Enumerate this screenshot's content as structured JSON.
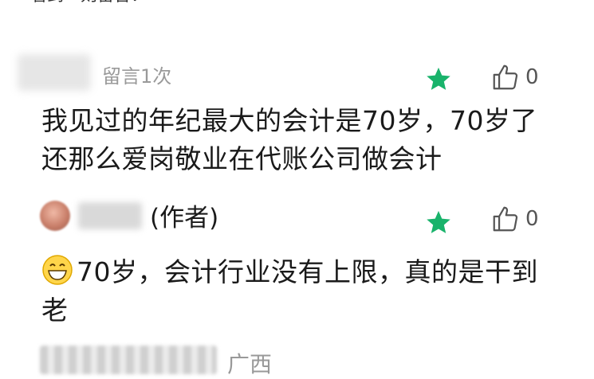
{
  "header": {
    "cut_text": "看到一则留言："
  },
  "comments": [
    {
      "meta": "留言1次",
      "like_count": "0",
      "text": "我见过的年纪最大的会计是70岁，70岁了还那么爱岗敬业在代账公司做会计"
    },
    {
      "author_suffix": "(作者)",
      "like_count": "0",
      "text": "70岁，会计行业没有上限，真的是干到老"
    }
  ],
  "footer": {
    "location": "广西"
  },
  "colors": {
    "star": "#19b36b",
    "meta": "#9a9a9a"
  }
}
